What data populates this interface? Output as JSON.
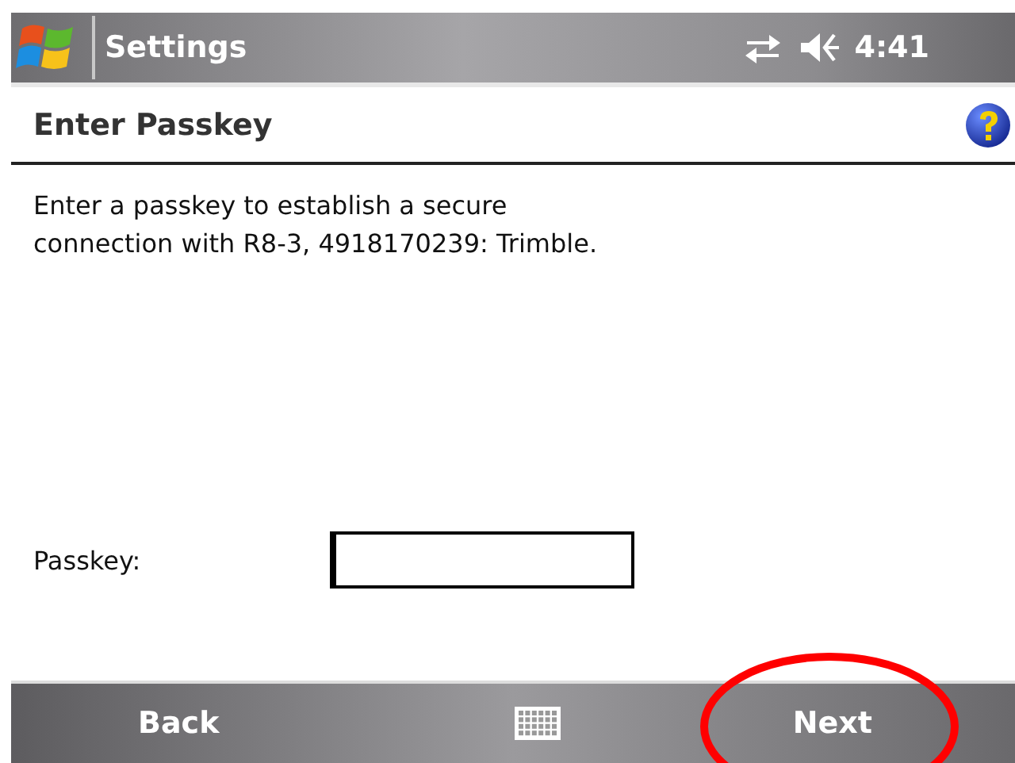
{
  "title_bar": {
    "title": "Settings",
    "time": "4:41"
  },
  "header": {
    "title": "Enter Passkey"
  },
  "message": "Enter a passkey to establish a secure connection with R8-3, 4918170239: Trimble.",
  "passkey_field": {
    "label": "Passkey:"
  },
  "softkeys": [
    {
      "label": "Back"
    },
    {
      "label": "Next"
    }
  ]
}
